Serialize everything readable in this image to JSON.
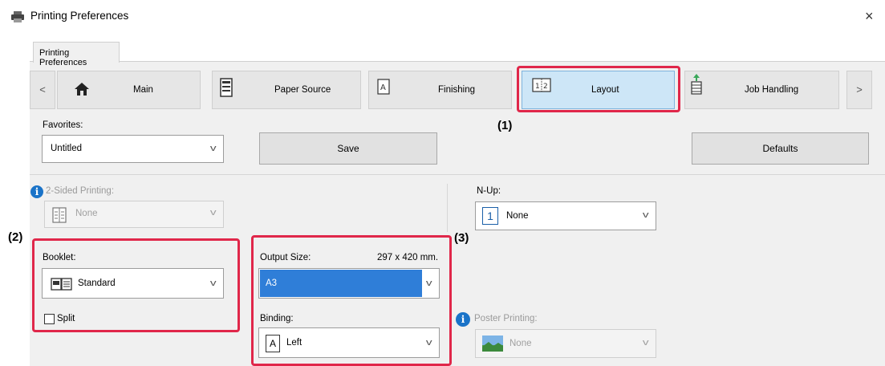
{
  "window": {
    "title": "Printing Preferences",
    "close_glyph": "×"
  },
  "tab": {
    "label": "Printing Preferences"
  },
  "nav": {
    "prev_glyph": "<",
    "next_glyph": ">",
    "items": [
      {
        "label": "Main",
        "icon": "home-icon"
      },
      {
        "label": "Paper Source",
        "icon": "paper-tray-icon"
      },
      {
        "label": "Finishing",
        "icon": "finishing-icon"
      },
      {
        "label": "Layout",
        "icon": "layout-icon",
        "selected": true
      },
      {
        "label": "Job Handling",
        "icon": "job-handling-icon"
      }
    ]
  },
  "favorites": {
    "label": "Favorites:",
    "value": "Untitled",
    "save_label": "Save",
    "defaults_label": "Defaults"
  },
  "two_sided": {
    "label": "2-Sided Printing:",
    "value": "None",
    "disabled": true
  },
  "nup": {
    "label": "N-Up:",
    "value": "None"
  },
  "booklet": {
    "label": "Booklet:",
    "value": "Standard",
    "split_label": "Split",
    "split_checked": false
  },
  "output_size": {
    "label": "Output Size:",
    "dims": "297 x 420 mm.",
    "value": "A3"
  },
  "binding": {
    "label": "Binding:",
    "value": "Left"
  },
  "poster": {
    "label": "Poster Printing:",
    "value": "None",
    "disabled": true
  },
  "callouts": {
    "c1": "(1)",
    "c2": "(2)",
    "c3": "(3)"
  },
  "colors": {
    "highlight": "#e0274a",
    "selected_tab": "#cde6f7",
    "selected_option": "#2f7ed8"
  }
}
